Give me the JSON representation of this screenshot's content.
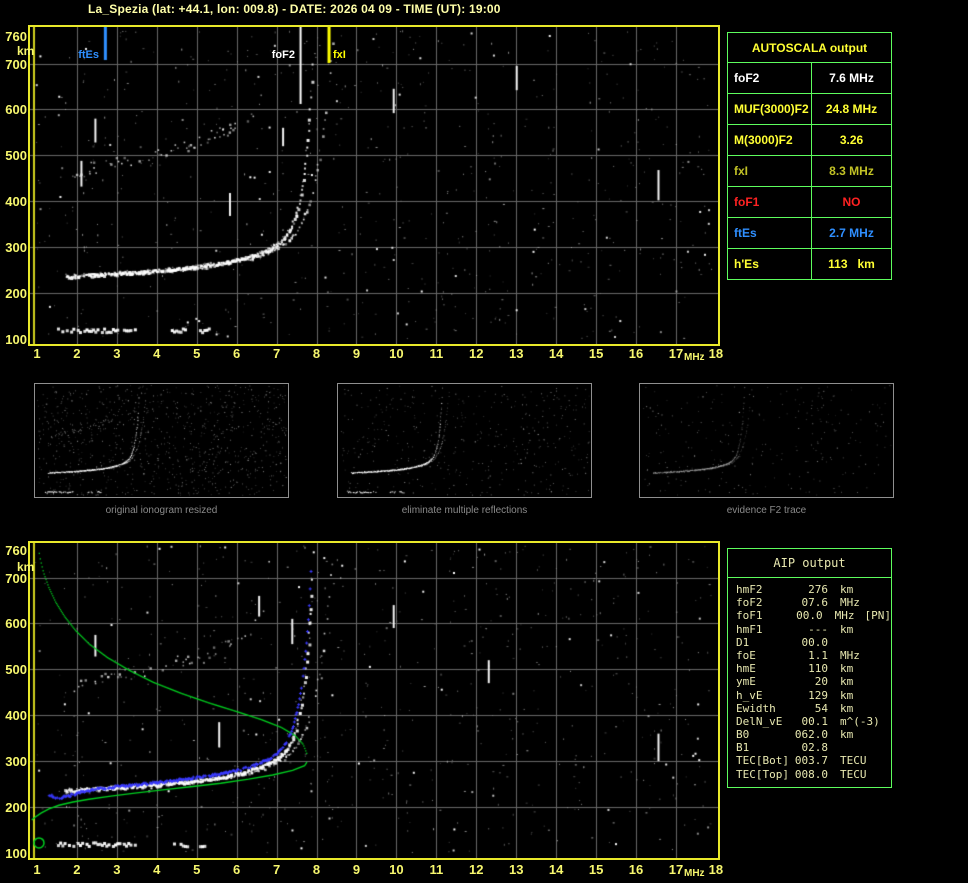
{
  "header": {
    "title": "La_Spezia (lat: +44.1, lon: 009.8) - DATE: 2026 04 09 - TIME (UT): 19:00"
  },
  "autoscala_table": {
    "title": "AUTOSCALA output",
    "rows": [
      {
        "label": "foF2",
        "value": "7.6 MHz",
        "color": "#ffffff"
      },
      {
        "label": "MUF(3000)F2",
        "value": "24.8 MHz",
        "color": "#ffff33"
      },
      {
        "label": "M(3000)F2",
        "value": "3.26",
        "color": "#ffff33"
      },
      {
        "label": "fxI",
        "value": "8.3 MHz",
        "color": "#c2c226"
      },
      {
        "label": "foF1",
        "value": "NO",
        "color": "#ff2222"
      },
      {
        "label": "ftEs",
        "value": "2.7 MHz",
        "color": "#2f8fff"
      },
      {
        "label": "h'Es",
        "value": "113   km",
        "color": "#ffff33"
      }
    ]
  },
  "aip_table": {
    "title": "AIP output",
    "rows": [
      {
        "label": "hmF2",
        "value": "276",
        "unit": "km",
        "extra": ""
      },
      {
        "label": "foF2",
        "value": "07.6",
        "unit": "MHz",
        "extra": ""
      },
      {
        "label": "foF1",
        "value": "00.0",
        "unit": "MHz",
        "extra": "[PN]"
      },
      {
        "label": "hmF1",
        "value": "---",
        "unit": "km",
        "extra": ""
      },
      {
        "label": "D1",
        "value": "00.0",
        "unit": "",
        "extra": ""
      },
      {
        "label": "foE",
        "value": "1.1",
        "unit": "MHz",
        "extra": ""
      },
      {
        "label": "hmE",
        "value": "110",
        "unit": "km",
        "extra": ""
      },
      {
        "label": "ymE",
        "value": "20",
        "unit": "km",
        "extra": ""
      },
      {
        "label": "h_vE",
        "value": "129",
        "unit": "km",
        "extra": ""
      },
      {
        "label": "Ewidth",
        "value": "54",
        "unit": "km",
        "extra": ""
      },
      {
        "label": "DelN_vE",
        "value": "00.1",
        "unit": "m^(-3)",
        "extra": ""
      },
      {
        "label": "B0",
        "value": "062.0",
        "unit": "km",
        "extra": ""
      },
      {
        "label": "B1",
        "value": "02.8",
        "unit": "",
        "extra": ""
      },
      {
        "label": "TEC[Bot]",
        "value": "003.7",
        "unit": "TECU",
        "extra": ""
      },
      {
        "label": "TEC[Top]",
        "value": "008.0",
        "unit": "TECU",
        "extra": ""
      }
    ]
  },
  "thumbnails": [
    {
      "caption": "original ionogram resized"
    },
    {
      "caption": "eliminate multiple reflections"
    },
    {
      "caption": "evidence F2 trace"
    }
  ],
  "chart_data": [
    {
      "id": "main_ionogram",
      "type": "scatter",
      "title": "scaled ionogram with AUTOSCALA markers",
      "xlabel": "MHz",
      "ylabel": "km",
      "x_range": [
        1,
        18
      ],
      "y_range": [
        100,
        760
      ],
      "x_ticks": [
        1,
        2,
        3,
        4,
        5,
        6,
        7,
        8,
        9,
        10,
        11,
        12,
        13,
        14,
        15,
        16,
        17,
        18
      ],
      "y_ticks": [
        760,
        700,
        600,
        500,
        400,
        300,
        200,
        100
      ],
      "grid": true,
      "noise_seed": 1234,
      "markers": [
        {
          "name": "ftEs",
          "mhz": 2.7,
          "color": "#2f8fff",
          "len": 33,
          "lw": 3
        },
        {
          "name": "foF2",
          "mhz": 7.6,
          "color": "#ffffff",
          "len": 77,
          "lw": 2
        },
        {
          "name": "fxI",
          "mhz": 8.3,
          "color": "#ffff00",
          "len": 36,
          "lw": 3
        }
      ],
      "traces": {
        "o_trace": [
          [
            1.7,
            237
          ],
          [
            2.2,
            240
          ],
          [
            2.8,
            243
          ],
          [
            3.4,
            246
          ],
          [
            4.0,
            250
          ],
          [
            4.6,
            255
          ],
          [
            5.2,
            261
          ],
          [
            5.7,
            268
          ],
          [
            6.1,
            276
          ],
          [
            6.5,
            286
          ],
          [
            6.8,
            297
          ],
          [
            7.05,
            310
          ],
          [
            7.2,
            324
          ],
          [
            7.35,
            343
          ],
          [
            7.45,
            368
          ],
          [
            7.55,
            400
          ],
          [
            7.63,
            440
          ],
          [
            7.7,
            485
          ],
          [
            7.76,
            535
          ],
          [
            7.81,
            590
          ],
          [
            7.85,
            645
          ],
          [
            7.88,
            700
          ],
          [
            7.9,
            758
          ]
        ],
        "x_trace": [
          [
            4.6,
            252
          ],
          [
            5.2,
            259
          ],
          [
            5.8,
            267
          ],
          [
            6.3,
            276
          ],
          [
            6.7,
            287
          ],
          [
            7.0,
            298
          ],
          [
            7.25,
            312
          ],
          [
            7.45,
            330
          ],
          [
            7.6,
            352
          ],
          [
            7.75,
            382
          ],
          [
            7.88,
            418
          ],
          [
            7.98,
            458
          ],
          [
            8.08,
            505
          ],
          [
            8.17,
            558
          ],
          [
            8.25,
            615
          ],
          [
            8.32,
            675
          ],
          [
            8.38,
            735
          ],
          [
            8.42,
            758
          ]
        ],
        "second_hop": [
          [
            1.9,
            462
          ],
          [
            2.2,
            470
          ],
          [
            2.6,
            478
          ],
          [
            3.1,
            487
          ],
          [
            3.6,
            497
          ],
          [
            4.1,
            508
          ],
          [
            4.6,
            520
          ],
          [
            5.1,
            533
          ],
          [
            5.5,
            547
          ],
          [
            5.9,
            562
          ],
          [
            6.2,
            578
          ],
          [
            6.45,
            598
          ],
          [
            6.6,
            622
          ],
          [
            6.7,
            650
          ],
          [
            6.76,
            685
          ],
          [
            6.8,
            725
          ],
          [
            6.82,
            758
          ]
        ],
        "es_segments": [
          [
            1.5,
            3.45
          ],
          [
            4.35,
            4.75
          ],
          [
            5.0,
            5.3
          ]
        ],
        "es_height_km": 121,
        "streaks": [
          [
            2.45,
            528,
            580
          ],
          [
            2.1,
            432,
            488
          ],
          [
            5.82,
            368,
            418
          ],
          [
            9.92,
            592,
            645
          ],
          [
            13.0,
            642,
            695
          ],
          [
            16.55,
            402,
            468
          ],
          [
            7.15,
            520,
            560
          ]
        ]
      }
    },
    {
      "id": "aip_ionogram",
      "type": "scatter",
      "title": "ionogram with AIP fitted trace and electron density profile",
      "xlabel": "MHz",
      "ylabel": "km",
      "x_range": [
        1,
        18
      ],
      "y_range": [
        100,
        760
      ],
      "x_ticks": [
        1,
        2,
        3,
        4,
        5,
        6,
        7,
        8,
        9,
        10,
        11,
        12,
        13,
        14,
        15,
        16,
        17,
        18
      ],
      "y_ticks": [
        760,
        700,
        600,
        500,
        400,
        300,
        200,
        100
      ],
      "grid": true,
      "noise_seed": 5678,
      "markers": [],
      "traces": {
        "o_trace": [
          [
            1.7,
            237
          ],
          [
            2.2,
            240
          ],
          [
            2.8,
            243
          ],
          [
            3.4,
            246
          ],
          [
            4.0,
            250
          ],
          [
            4.6,
            255
          ],
          [
            5.2,
            261
          ],
          [
            5.7,
            268
          ],
          [
            6.1,
            276
          ],
          [
            6.5,
            286
          ],
          [
            6.8,
            297
          ],
          [
            7.05,
            310
          ],
          [
            7.2,
            324
          ],
          [
            7.35,
            343
          ],
          [
            7.45,
            368
          ],
          [
            7.55,
            400
          ],
          [
            7.63,
            440
          ],
          [
            7.7,
            485
          ],
          [
            7.76,
            535
          ],
          [
            7.81,
            590
          ],
          [
            7.85,
            645
          ],
          [
            7.88,
            700
          ],
          [
            7.9,
            758
          ]
        ],
        "x_trace": [
          [
            4.6,
            252
          ],
          [
            5.2,
            259
          ],
          [
            5.8,
            267
          ],
          [
            6.3,
            276
          ],
          [
            6.7,
            287
          ],
          [
            7.0,
            298
          ],
          [
            7.25,
            312
          ],
          [
            7.45,
            330
          ],
          [
            7.6,
            352
          ],
          [
            7.75,
            382
          ],
          [
            7.88,
            418
          ],
          [
            7.98,
            458
          ],
          [
            8.08,
            505
          ],
          [
            8.17,
            558
          ],
          [
            8.25,
            615
          ],
          [
            8.32,
            675
          ],
          [
            8.38,
            735
          ],
          [
            8.42,
            758
          ]
        ],
        "second_hop": [
          [
            1.9,
            462
          ],
          [
            2.2,
            470
          ],
          [
            2.6,
            478
          ],
          [
            3.1,
            487
          ],
          [
            3.6,
            497
          ],
          [
            4.1,
            508
          ],
          [
            4.6,
            520
          ],
          [
            5.1,
            533
          ],
          [
            5.5,
            547
          ],
          [
            5.9,
            562
          ],
          [
            6.2,
            578
          ],
          [
            6.45,
            598
          ],
          [
            6.6,
            622
          ],
          [
            6.7,
            650
          ],
          [
            6.76,
            685
          ],
          [
            6.8,
            725
          ],
          [
            6.82,
            758
          ]
        ],
        "es_segments": [
          [
            1.5,
            3.45
          ],
          [
            4.35,
            4.75
          ],
          [
            5.0,
            5.3
          ]
        ],
        "es_height_km": 121,
        "streaks": [
          [
            2.45,
            528,
            575
          ],
          [
            5.55,
            330,
            385
          ],
          [
            7.38,
            555,
            610
          ],
          [
            9.92,
            590,
            640
          ],
          [
            12.3,
            470,
            520
          ],
          [
            16.55,
            300,
            360
          ],
          [
            6.55,
            615,
            660
          ]
        ]
      },
      "profile": {
        "color": "#00d020",
        "top_branch": [
          [
            1.03,
            760
          ],
          [
            1.07,
            740
          ],
          [
            1.15,
            712
          ],
          [
            1.28,
            680
          ],
          [
            1.45,
            648
          ],
          [
            1.68,
            616
          ],
          [
            1.95,
            586
          ],
          [
            2.3,
            556
          ],
          [
            2.75,
            527
          ],
          [
            3.3,
            499
          ],
          [
            3.9,
            473
          ],
          [
            4.6,
            449
          ],
          [
            5.3,
            428
          ],
          [
            6.0,
            409
          ],
          [
            6.6,
            392
          ],
          [
            7.1,
            375
          ],
          [
            7.45,
            357
          ],
          [
            7.65,
            338
          ],
          [
            7.74,
            318
          ],
          [
            7.76,
            305
          ]
        ],
        "bottom_branch": [
          [
            7.76,
            298
          ],
          [
            7.7,
            290
          ],
          [
            7.4,
            280
          ],
          [
            6.9,
            270
          ],
          [
            6.3,
            261
          ],
          [
            5.6,
            252
          ],
          [
            4.9,
            245
          ],
          [
            4.2,
            238
          ],
          [
            3.5,
            231
          ],
          [
            2.85,
            224
          ],
          [
            2.3,
            217
          ],
          [
            1.9,
            211
          ],
          [
            1.55,
            204
          ],
          [
            1.3,
            196
          ],
          [
            1.1,
            187
          ],
          [
            0.95,
            178
          ],
          [
            0.87,
            172
          ]
        ],
        "e_circle": {
          "mhz": 1.05,
          "km": 122,
          "r": 5
        }
      },
      "fitted_trace": {
        "color": "#3a3aff",
        "points": [
          [
            1.25,
            224
          ],
          [
            1.5,
            217
          ],
          [
            1.75,
            220
          ],
          [
            2.1,
            230
          ],
          [
            2.5,
            236
          ],
          [
            3.0,
            241
          ],
          [
            3.5,
            245
          ],
          [
            4.0,
            250
          ],
          [
            4.5,
            255
          ],
          [
            5.0,
            261
          ],
          [
            5.5,
            267
          ],
          [
            5.9,
            274
          ],
          [
            6.3,
            283
          ],
          [
            6.6,
            293
          ],
          [
            6.85,
            304
          ],
          [
            7.05,
            317
          ],
          [
            7.2,
            333
          ],
          [
            7.33,
            354
          ],
          [
            7.43,
            380
          ],
          [
            7.52,
            412
          ],
          [
            7.6,
            450
          ],
          [
            7.67,
            495
          ],
          [
            7.73,
            545
          ],
          [
            7.78,
            600
          ],
          [
            7.82,
            655
          ],
          [
            7.85,
            710
          ],
          [
            7.87,
            752
          ]
        ]
      }
    }
  ]
}
